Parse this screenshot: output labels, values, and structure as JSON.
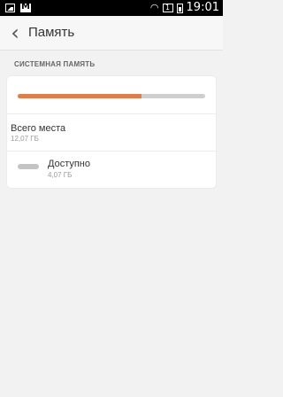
{
  "status_bar": {
    "time": "19:01",
    "icons": [
      "image-icon",
      "mail-icon",
      "wifi-icon",
      "signal-icon",
      "battery-icon"
    ]
  },
  "app_bar": {
    "title": "Память",
    "back_icon": "chevron-left-icon"
  },
  "section": {
    "label": "СИСТЕМНАЯ ПАМЯТЬ"
  },
  "storage": {
    "used_fraction": 0.66,
    "bar_colors": {
      "used": "#e07d4c",
      "free": "#cfcfcf"
    },
    "total_label": "Всего места",
    "total_value": "12,07 ГБ",
    "available_label": "Доступно",
    "available_value": "4,07 ГБ"
  }
}
